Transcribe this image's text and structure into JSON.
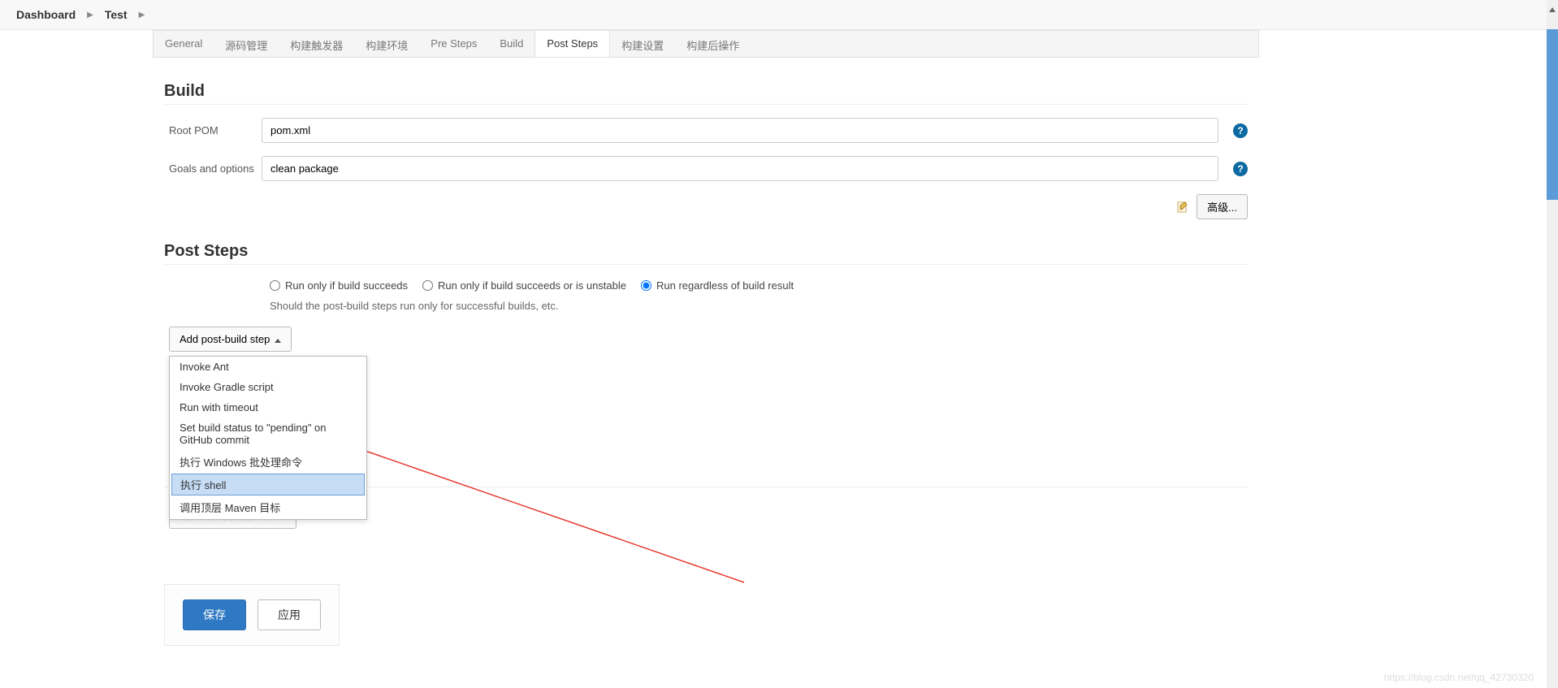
{
  "breadcrumb": {
    "root": "Dashboard",
    "current": "Test"
  },
  "tabs": [
    {
      "label": "General"
    },
    {
      "label": "源码管理"
    },
    {
      "label": "构建触发器"
    },
    {
      "label": "构建环境"
    },
    {
      "label": "Pre Steps"
    },
    {
      "label": "Build"
    },
    {
      "label": "Post Steps"
    },
    {
      "label": "构建设置"
    },
    {
      "label": "构建后操作"
    }
  ],
  "build": {
    "title": "Build",
    "rootPomLabel": "Root POM",
    "rootPomValue": "pom.xml",
    "goalsLabel": "Goals and options",
    "goalsValue": "clean package",
    "advancedBtn": "高级..."
  },
  "postSteps": {
    "title": "Post Steps",
    "radios": {
      "r1": "Run only if build succeeds",
      "r2": "Run only if build succeeds or is unstable",
      "r3": "Run regardless of build result"
    },
    "helper": "Should the post-build steps run only for successful builds, etc.",
    "addBtn": "Add post-build step",
    "menu": [
      "Invoke Ant",
      "Invoke Gradle script",
      "Run with timeout",
      "Set build status to \"pending\" on GitHub commit",
      "执行 Windows 批处理命令",
      "执行 shell",
      "调用顶层 Maven 目标"
    ]
  },
  "postBuildActions": {
    "addBtn": "增加构建后操作步骤"
  },
  "actions": {
    "save": "保存",
    "apply": "应用"
  },
  "watermark": "https://blog.csdn.net/qq_42730320"
}
